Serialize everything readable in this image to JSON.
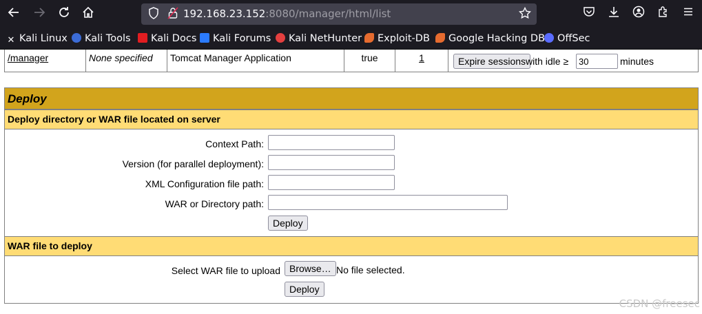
{
  "browser": {
    "url_host": "192.168.23.152",
    "url_rest": ":8080/manager/html/list",
    "bookmarks": [
      {
        "label": "Kali Linux",
        "icon": "kali-dragon-icon",
        "color": "#367bf0"
      },
      {
        "label": "Kali Tools",
        "icon": "kali-tools-icon",
        "color": "#ff5c5c"
      },
      {
        "label": "Kali Docs",
        "icon": "kali-docs-icon",
        "color": "#e11d21"
      },
      {
        "label": "Kali Forums",
        "icon": "kali-forums-icon",
        "color": "#2b7bff"
      },
      {
        "label": "Kali NetHunter",
        "icon": "nethunter-icon",
        "color": "#e43f3f"
      },
      {
        "label": "Exploit-DB",
        "icon": "exploit-db-icon",
        "color": "#e66b2f"
      },
      {
        "label": "Google Hacking DB",
        "icon": "ghdb-icon",
        "color": "#e66b2f"
      },
      {
        "label": "OffSec",
        "icon": "offsec-icon",
        "color": "#5a6cff"
      }
    ]
  },
  "app_row": {
    "path": "/manager",
    "version": "None specified",
    "display_name": "Tomcat Manager Application",
    "running": "true",
    "sessions": "1",
    "expire_button": "Expire sessions",
    "with_idle": "with idle ≥",
    "idle_value": "30",
    "minutes": "minutes"
  },
  "deploy": {
    "title": "Deploy",
    "server_heading": "Deploy directory or WAR file located on server",
    "context_path_label": "Context Path:",
    "version_label": "Version (for parallel deployment):",
    "xml_config_label": "XML Configuration file path:",
    "war_dir_label": "WAR or Directory path:",
    "deploy_button": "Deploy",
    "war_heading": "WAR file to deploy",
    "select_war_label": "Select WAR file to upload",
    "browse_button": "Browse…",
    "no_file": "No file selected.",
    "deploy_button_2": "Deploy"
  },
  "watermark": "CSDN @freesec"
}
